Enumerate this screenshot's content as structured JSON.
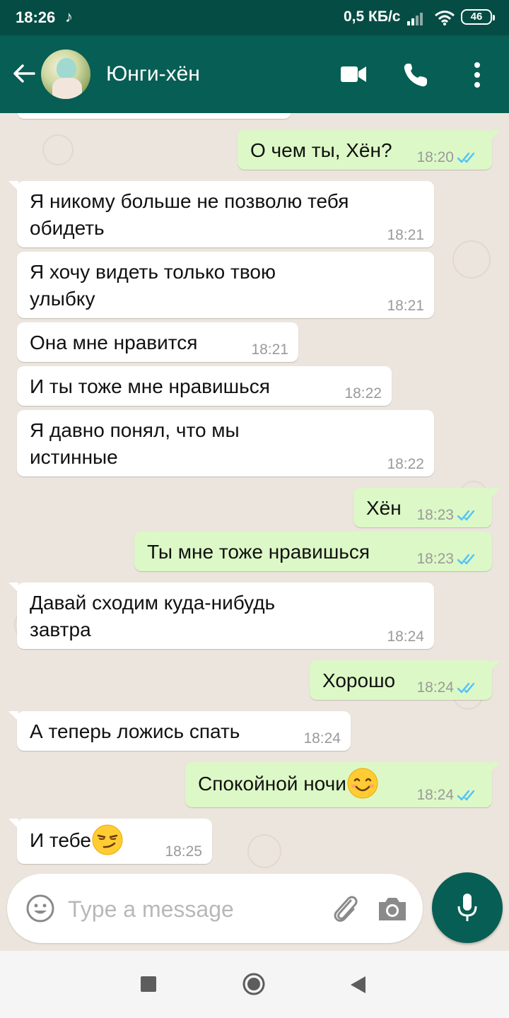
{
  "status_bar": {
    "time": "18:26",
    "tiktok_glyph": "♪",
    "network_speed": "0,5 КБ/с",
    "battery": "46",
    "icons": [
      "tiktok-icon",
      "signal-icon",
      "wifi-icon",
      "battery-icon"
    ]
  },
  "header": {
    "contact_name": "Юнги-хён",
    "icons": [
      "back-arrow-icon",
      "video-call-icon",
      "phone-icon",
      "more-vert-icon"
    ]
  },
  "messages": [
    {
      "dir": "out",
      "text": "О чем ты, Хён?",
      "time": "18:20",
      "read": true
    },
    {
      "dir": "in",
      "text": "Я никому больше не позволю тебя обидеть",
      "time": "18:21"
    },
    {
      "dir": "in",
      "text": "Я хочу видеть только твою улыбку",
      "time": "18:21"
    },
    {
      "dir": "in",
      "text": "Она мне нравится",
      "time": "18:21"
    },
    {
      "dir": "in",
      "text": "И ты тоже мне нравишься",
      "time": "18:22"
    },
    {
      "dir": "in",
      "text": "Я давно понял, что мы истинные",
      "time": "18:22"
    },
    {
      "dir": "out",
      "text": "Хён",
      "time": "18:23",
      "read": true
    },
    {
      "dir": "out",
      "text": "Ты мне тоже нравишься",
      "time": "18:23",
      "read": true
    },
    {
      "dir": "in",
      "text": "Давай сходим куда-нибудь завтра",
      "time": "18:24"
    },
    {
      "dir": "out",
      "text": "Хорошо",
      "time": "18:24",
      "read": true
    },
    {
      "dir": "in",
      "text": "А теперь ложись спать",
      "time": "18:24"
    },
    {
      "dir": "out",
      "text": "Спокойной ночи",
      "time": "18:24",
      "read": true,
      "emoji": "smiling-face-icon"
    },
    {
      "dir": "in",
      "text": "И тебе",
      "time": "18:25",
      "emoji": "smirking-face-icon"
    }
  ],
  "composer": {
    "placeholder": "Type a message",
    "value": "",
    "icons": [
      "emoji-icon",
      "attach-icon",
      "camera-icon",
      "mic-icon"
    ]
  },
  "colors": {
    "header": "#075e54",
    "status_bar": "#054d44",
    "chat_background": "#ece5dd",
    "incoming_bubble": "#ffffff",
    "outgoing_bubble": "#dcf8c6",
    "read_ticks": "#4fc3f7"
  },
  "nav_bar": {
    "icons": [
      "recents-square-icon",
      "home-circle-icon",
      "back-triangle-icon"
    ]
  }
}
